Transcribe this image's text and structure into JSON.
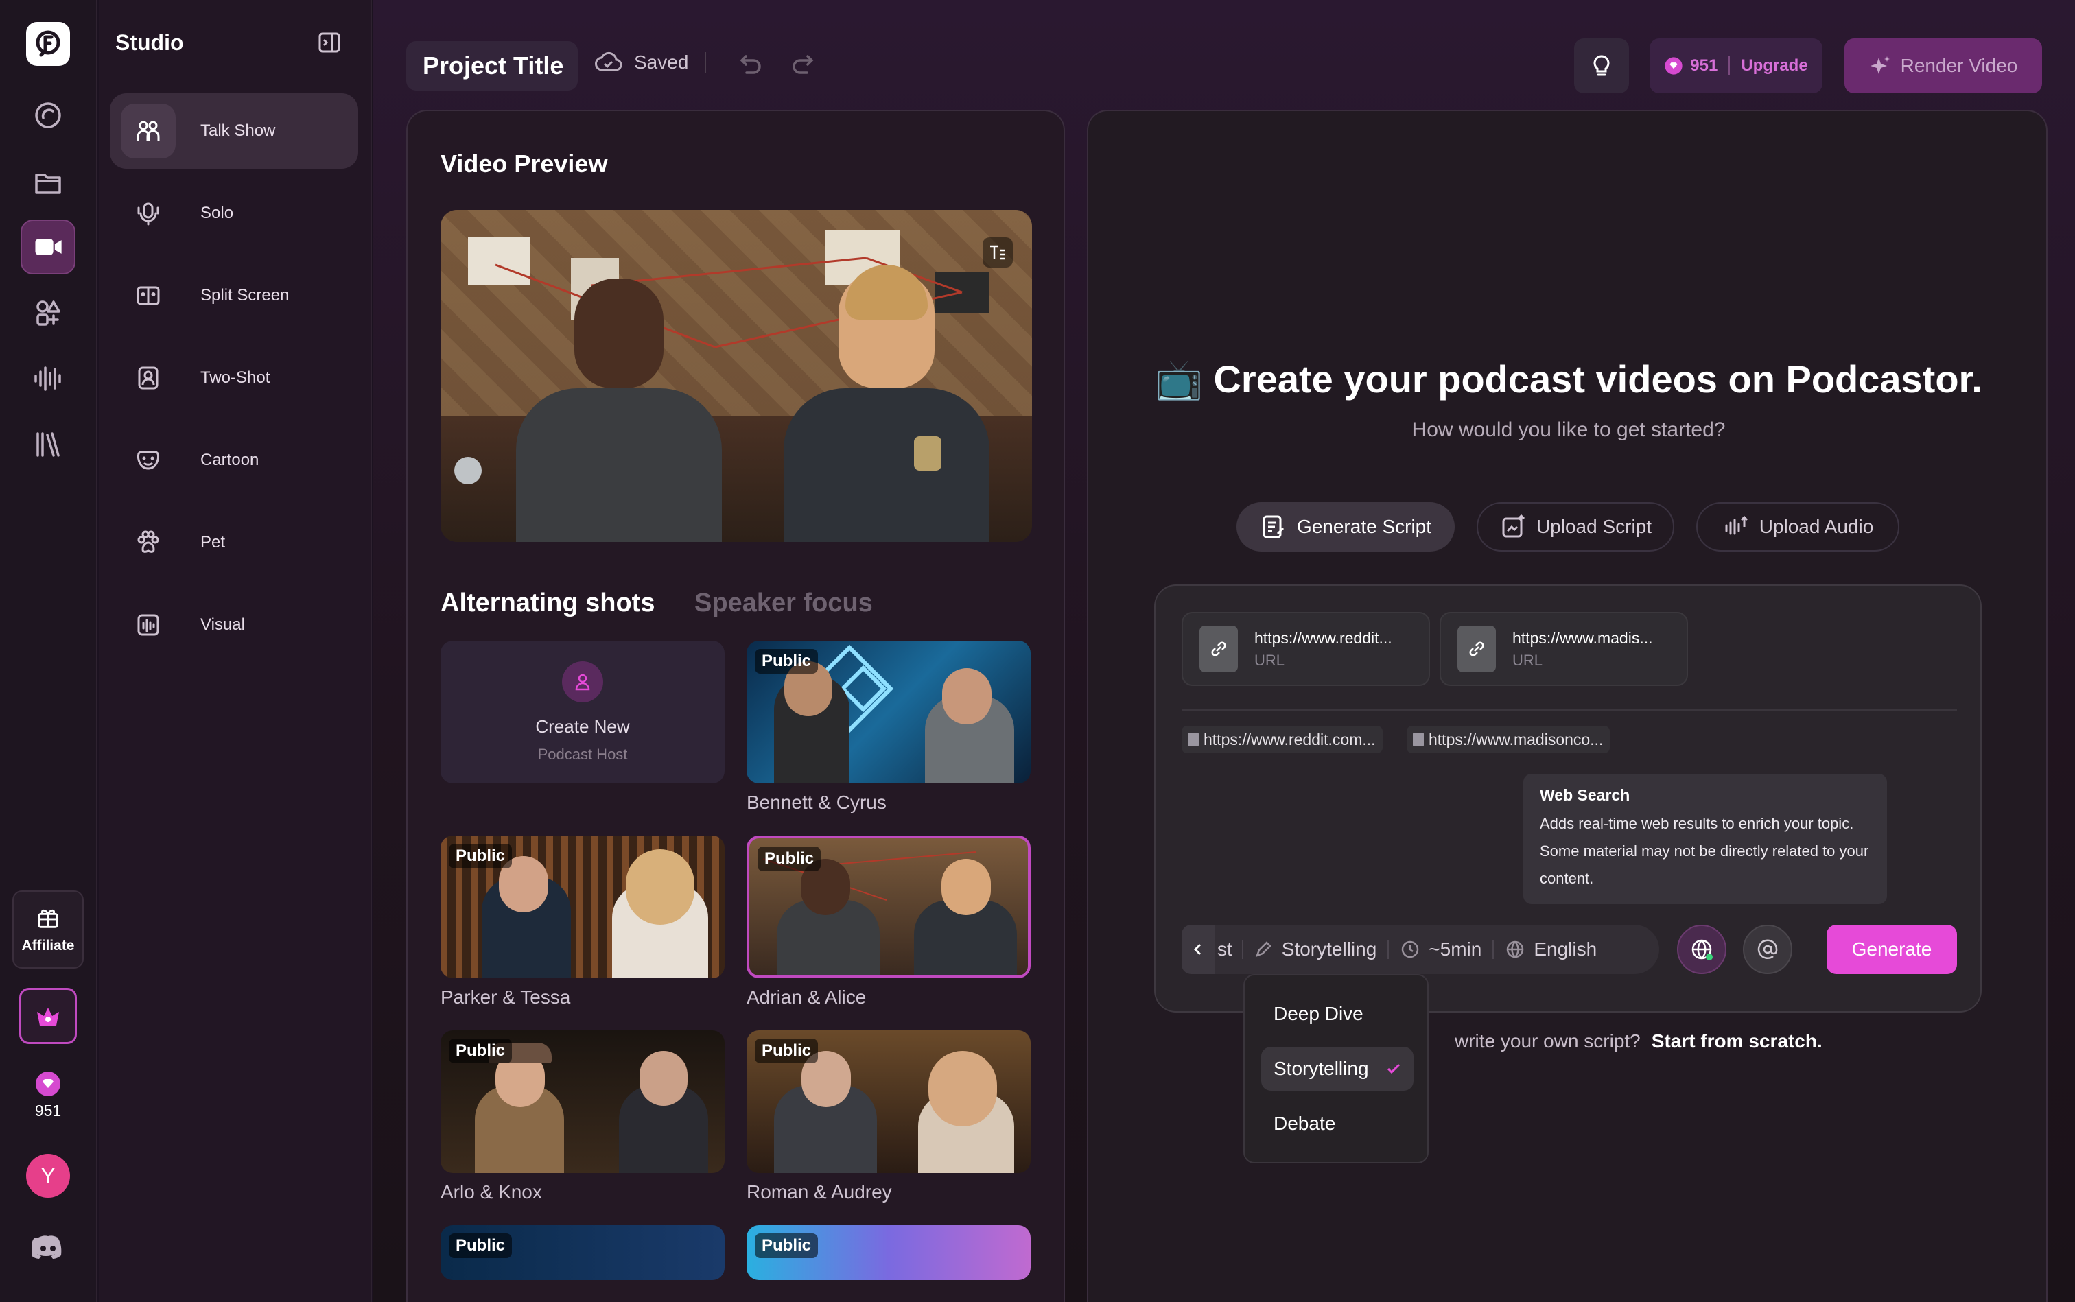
{
  "app": {
    "name": "Studio"
  },
  "rail": {
    "affiliate_label": "Affiliate",
    "credits": "951",
    "avatar_letter": "Y"
  },
  "sidebar": {
    "items": [
      {
        "label": "Talk Show",
        "icon": "talk-show-icon"
      },
      {
        "label": "Solo",
        "icon": "mic-icon"
      },
      {
        "label": "Split Screen",
        "icon": "split-screen-icon"
      },
      {
        "label": "Two-Shot",
        "icon": "two-shot-icon"
      },
      {
        "label": "Cartoon",
        "icon": "cartoon-icon"
      },
      {
        "label": "Pet",
        "icon": "paw-icon"
      },
      {
        "label": "Visual",
        "icon": "visual-icon"
      }
    ]
  },
  "header": {
    "project_title": "Project Title",
    "save_status": "Saved",
    "credits": "951",
    "upgrade_label": "Upgrade",
    "render_label": "Render Video"
  },
  "preview": {
    "title": "Video Preview",
    "tab_active": "Alternating shots",
    "tab_inactive": "Speaker focus",
    "create_new_title": "Create New",
    "create_new_subtitle": "Podcast Host",
    "public_badge": "Public",
    "hosts": [
      "Bennett & Cyrus",
      "Parker & Tessa",
      "Adrian & Alice",
      "Arlo & Knox",
      "Roman & Audrey"
    ]
  },
  "colors": {
    "accent": "#e64ad8",
    "accent_dark": "#6a2a6e",
    "upgrade_text": "#d86fd8"
  },
  "create": {
    "emoji": "📺",
    "heading": "Create your podcast videos on Podcastor.",
    "subheading": "How would you like to get started?",
    "options": [
      "Generate Script",
      "Upload Script",
      "Upload Audio"
    ],
    "sources": [
      {
        "title": "https://www.reddit...",
        "type": "URL"
      },
      {
        "title": "https://www.madis...",
        "type": "URL"
      }
    ],
    "chips": [
      "https://www.reddit.com...",
      "https://www.madisonco..."
    ],
    "tooltip_title": "Web Search",
    "tooltip_body": "Adds real-time web results to enrich your topic. Some material may not be directly related to your content.",
    "toolbar": {
      "cut_text": "st",
      "style": "Storytelling",
      "length": "~5min",
      "language": "English"
    },
    "generate_label": "Generate",
    "footer_partial": "write your own script?",
    "footer_link": "Start from scratch.",
    "menu": [
      "Deep Dive",
      "Storytelling",
      "Debate"
    ]
  }
}
